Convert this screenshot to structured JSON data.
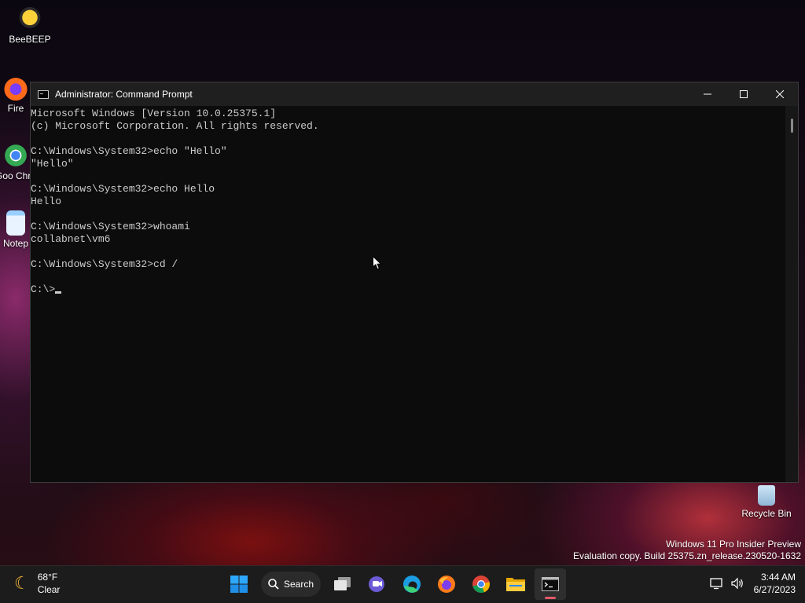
{
  "desktop": {
    "icons": [
      {
        "label": "BeeBEEP",
        "icon": "beebeep-icon"
      },
      {
        "label": "Fire",
        "icon": "firefox-icon"
      },
      {
        "label": "Goo Chro",
        "icon": "chrome-icon"
      },
      {
        "label": "Notep",
        "icon": "notepad-icon"
      },
      {
        "label": "Recycle Bin",
        "icon": "recycle-bin-icon"
      }
    ],
    "watermark": {
      "line1": "Windows 11 Pro Insider Preview",
      "line2": "Evaluation copy. Build 25375.zn_release.230520-1632"
    }
  },
  "window": {
    "title": "Administrator: Command Prompt",
    "controls": {
      "minimize": "—",
      "maximize": "☐",
      "close": "✕"
    },
    "console_lines": [
      "Microsoft Windows [Version 10.0.25375.1]",
      "(c) Microsoft Corporation. All rights reserved.",
      "",
      "C:\\Windows\\System32>echo \"Hello\"",
      "\"Hello\"",
      "",
      "C:\\Windows\\System32>echo Hello",
      "Hello",
      "",
      "C:\\Windows\\System32>whoami",
      "collabnet\\vm6",
      "",
      "C:\\Windows\\System32>cd /",
      "",
      "C:\\>"
    ]
  },
  "taskbar": {
    "weather": {
      "temp": "68°F",
      "condition": "Clear"
    },
    "search_label": "Search",
    "apps": [
      "start-icon",
      "search-icon",
      "task-view-icon",
      "chat-icon",
      "edge-icon",
      "firefox-icon",
      "chrome-icon",
      "file-explorer-icon",
      "terminal-icon"
    ],
    "time": "3:44 AM",
    "date": "6/27/2023"
  }
}
